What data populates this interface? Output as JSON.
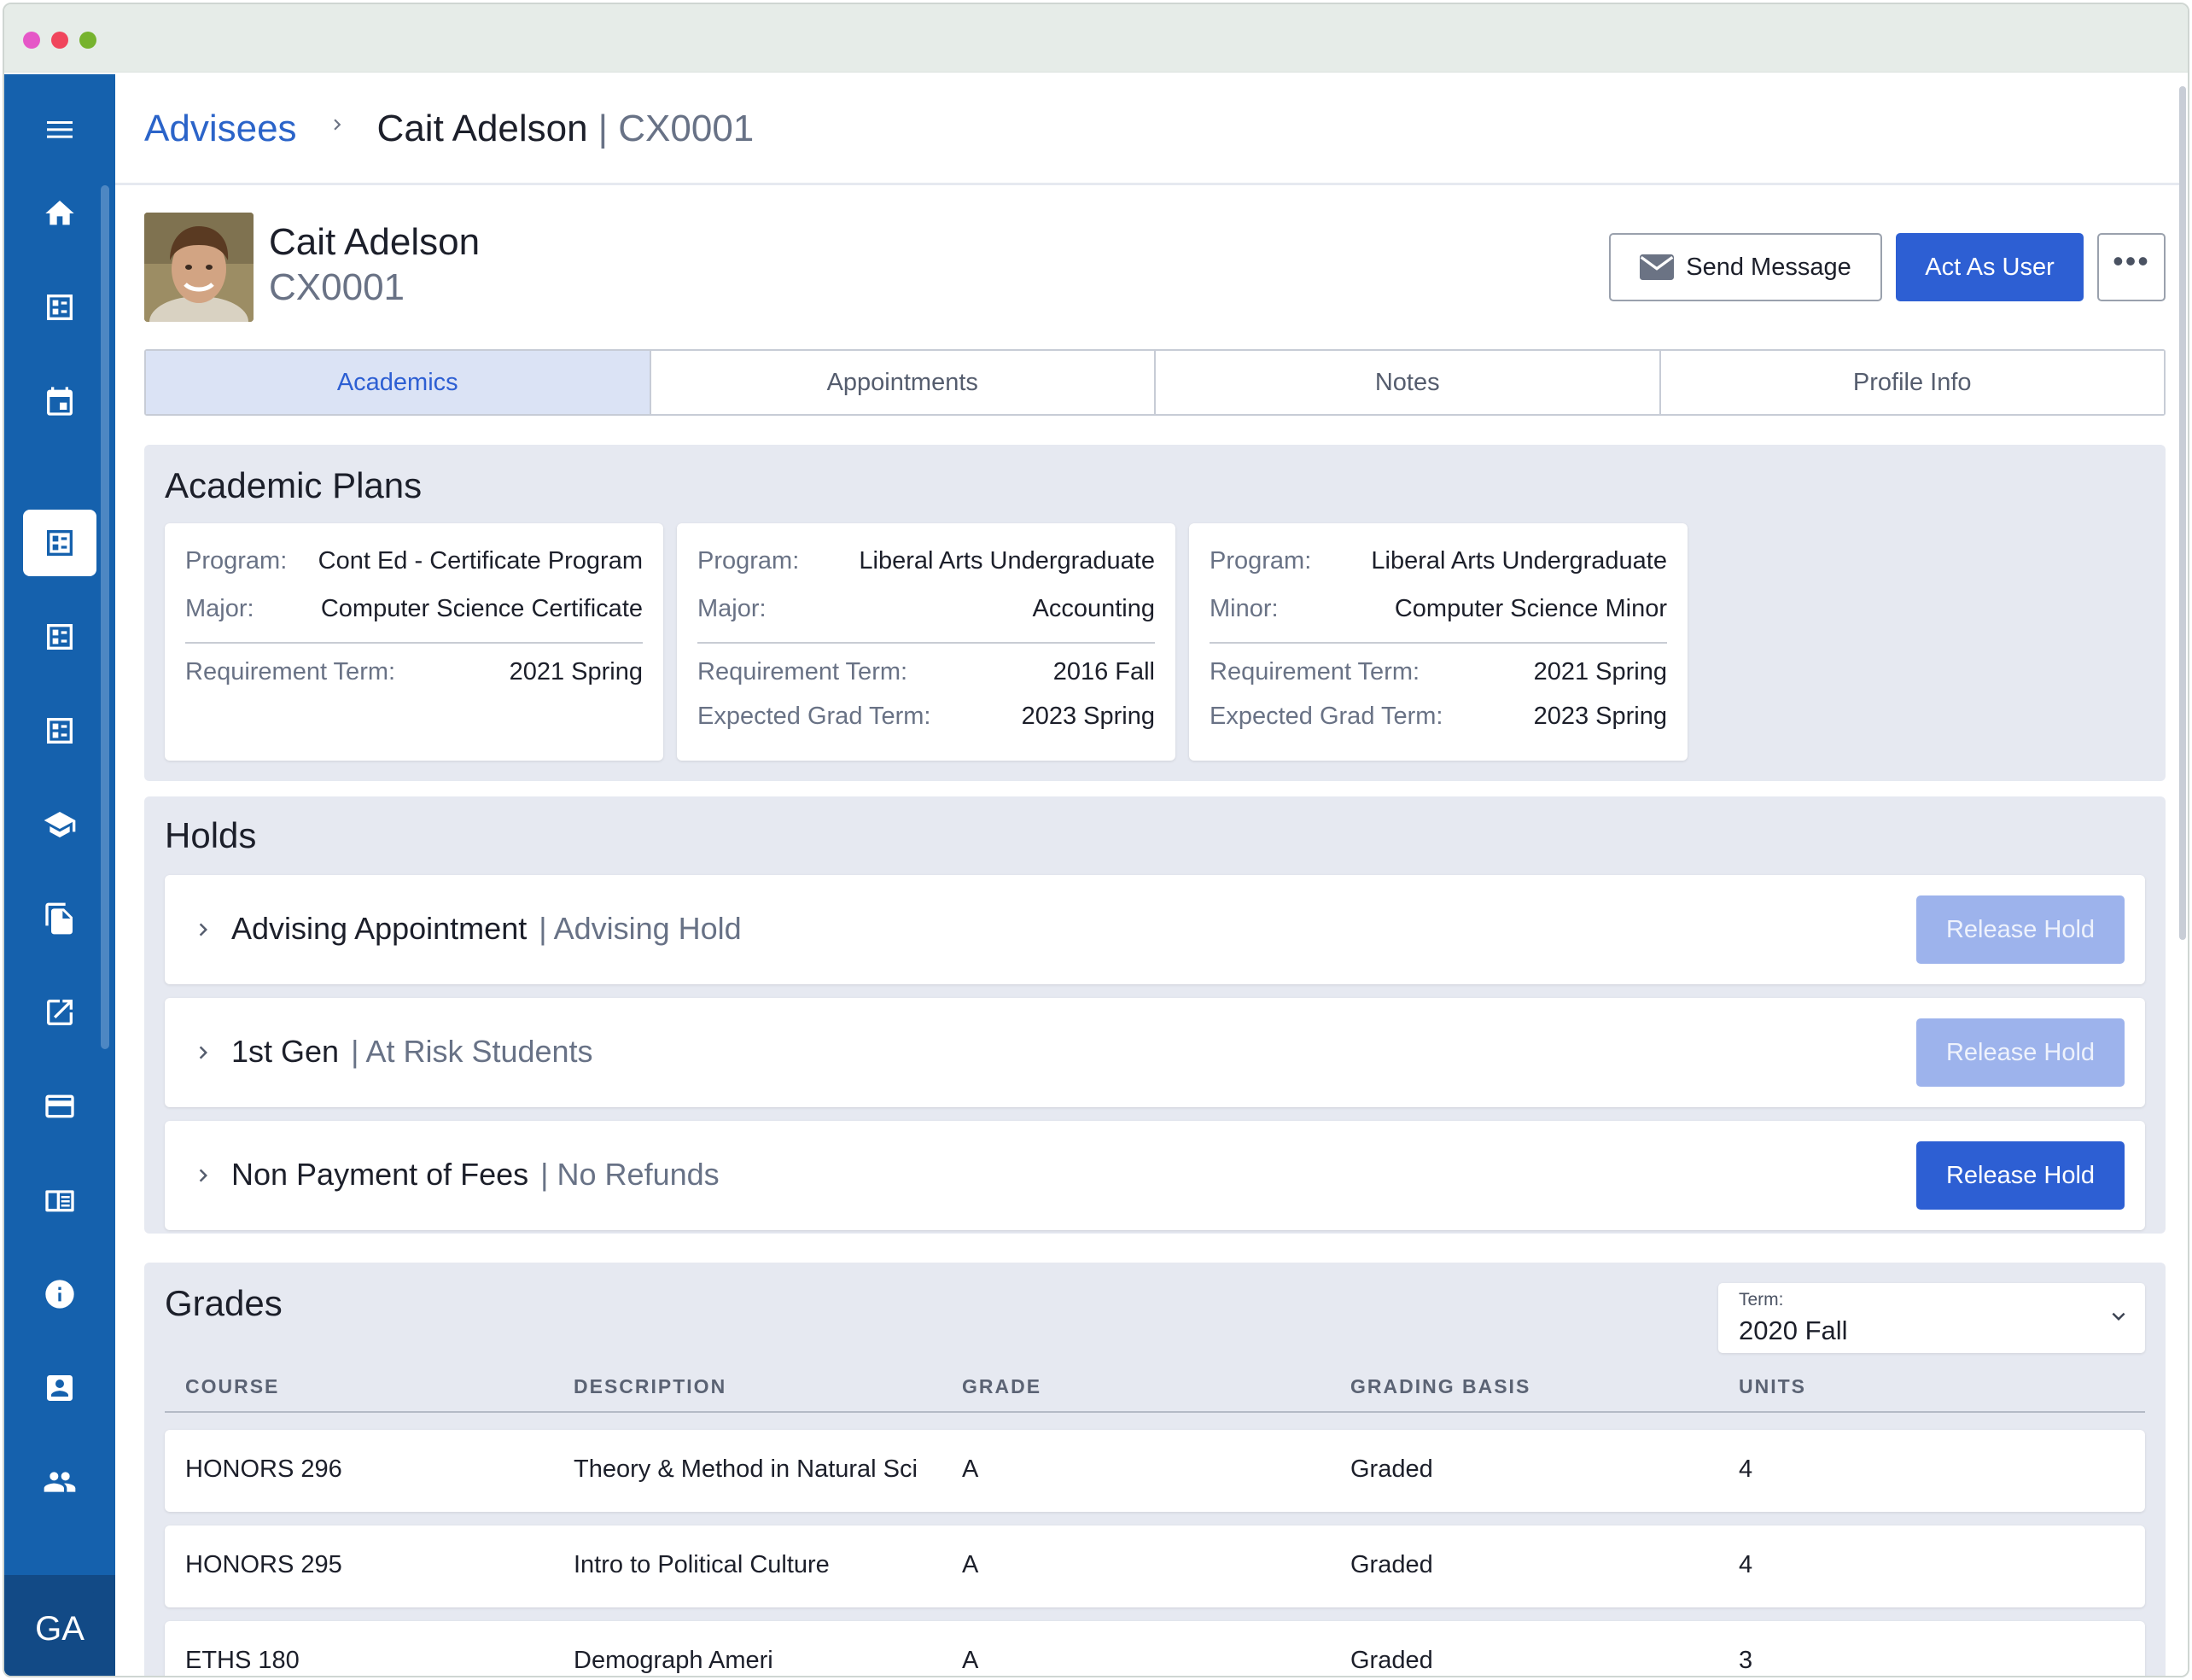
{
  "window": {
    "dot_colors": [
      "#e557c7",
      "#f0455c",
      "#76b32e"
    ]
  },
  "sidebar": {
    "items": [
      {
        "icon": "menu-icon"
      },
      {
        "icon": "home-icon"
      },
      {
        "icon": "dashboard-icon"
      },
      {
        "icon": "calendar-icon"
      },
      {
        "icon": "advisees-icon",
        "active": true
      },
      {
        "icon": "list-icon"
      },
      {
        "icon": "list-icon"
      },
      {
        "icon": "graduation-cap-icon"
      },
      {
        "icon": "documents-icon"
      },
      {
        "icon": "external-link-icon"
      },
      {
        "icon": "credit-card-icon"
      },
      {
        "icon": "catalog-icon"
      },
      {
        "icon": "info-icon"
      },
      {
        "icon": "contact-card-icon"
      },
      {
        "icon": "people-icon"
      }
    ],
    "avatar_initials": "GA",
    "brand_color": "#1561ad"
  },
  "header": {
    "breadcrumb_link": "Advisees",
    "breadcrumb_name": "Cait Adelson",
    "breadcrumb_id": "| CX0001"
  },
  "profile": {
    "name": "Cait Adelson",
    "id": "CX0001",
    "send_message_label": "Send Message",
    "act_as_user_label": "Act As User",
    "more_label": "•••"
  },
  "tabs": [
    {
      "label": "Academics",
      "active": true
    },
    {
      "label": "Appointments"
    },
    {
      "label": "Notes"
    },
    {
      "label": "Profile Info"
    }
  ],
  "academic_plans": {
    "title": "Academic Plans",
    "cards": [
      {
        "rows_top": [
          {
            "label": "Program:",
            "value": "Cont Ed - Certificate Program"
          },
          {
            "label": "Major:",
            "value": "Computer Science Certificate"
          }
        ],
        "rows_bottom": [
          {
            "label": "Requirement Term:",
            "value": "2021 Spring"
          }
        ]
      },
      {
        "rows_top": [
          {
            "label": "Program:",
            "value": "Liberal Arts Undergraduate"
          },
          {
            "label": "Major:",
            "value": "Accounting"
          }
        ],
        "rows_bottom": [
          {
            "label": "Requirement Term:",
            "value": "2016 Fall"
          },
          {
            "label": "Expected Grad Term:",
            "value": "2023 Spring"
          }
        ]
      },
      {
        "rows_top": [
          {
            "label": "Program:",
            "value": "Liberal Arts Undergraduate"
          },
          {
            "label": "Minor:",
            "value": "Computer Science Minor"
          }
        ],
        "rows_bottom": [
          {
            "label": "Requirement Term:",
            "value": "2021 Spring"
          },
          {
            "label": "Expected Grad Term:",
            "value": "2023 Spring"
          }
        ]
      }
    ]
  },
  "holds": {
    "title": "Holds",
    "items": [
      {
        "title": "Advising Appointment",
        "type": "| Advising Hold",
        "button": "Release Hold",
        "enabled": false
      },
      {
        "title": "1st Gen",
        "type": "| At Risk Students",
        "button": "Release Hold",
        "enabled": false
      },
      {
        "title": "Non Payment of Fees",
        "type": "| No Refunds",
        "button": "Release Hold",
        "enabled": true
      }
    ]
  },
  "grades": {
    "title": "Grades",
    "term_label": "Term:",
    "term_value": "2020 Fall",
    "columns": [
      "COURSE",
      "DESCRIPTION",
      "GRADE",
      "GRADING BASIS",
      "UNITS"
    ],
    "rows": [
      [
        "HONORS 296",
        "Theory & Method in Natural Sci",
        "A",
        "Graded",
        "4"
      ],
      [
        "HONORS 295",
        "Intro to Political Culture",
        "A",
        "Graded",
        "4"
      ],
      [
        "ETHS 180",
        "Demograph Ameri",
        "A",
        "Graded",
        "3"
      ]
    ]
  },
  "colors": {
    "accent": "#2d5fd3",
    "accent_disabled": "#9db3ec",
    "panel_bg": "#e6e9f1",
    "link": "#2b64c9"
  }
}
